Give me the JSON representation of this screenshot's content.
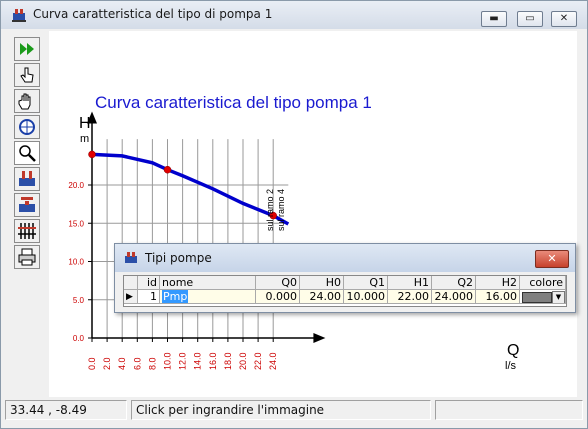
{
  "window": {
    "title": "Curva caratteristica del tipo di pompa 1"
  },
  "chart_data": {
    "type": "line",
    "title": "Curva caratteristica del tipo pompa 1",
    "ylabel": "H",
    "yunit": "m",
    "xlabel": "Q",
    "xunit": "l/s",
    "x_ticks": [
      "0.0",
      "2.0",
      "4.0",
      "6.0",
      "8.0",
      "10.0",
      "12.0",
      "14.0",
      "16.0",
      "18.0",
      "20.0",
      "22.0",
      "24.0"
    ],
    "y_ticks": [
      "0.0",
      "5.0",
      "10.0",
      "15.0",
      "20.0"
    ],
    "xlim": [
      0,
      28
    ],
    "ylim": [
      0,
      27
    ],
    "series": [
      {
        "x": [
          0,
          4,
          8,
          10,
          12,
          16,
          20,
          24,
          26
        ],
        "y": [
          24.0,
          23.8,
          22.9,
          22.0,
          21.2,
          19.5,
          17.6,
          16.0,
          14.9
        ]
      }
    ],
    "points": [
      {
        "x": 0,
        "y": 24.0
      },
      {
        "x": 10,
        "y": 22.0
      },
      {
        "x": 24,
        "y": 16.0
      }
    ],
    "annotations": [
      "sul ramo 2",
      "sul ramo 4"
    ],
    "grid": true,
    "color": "#0000cc",
    "tick_color": "#cc0000"
  },
  "statusbar": {
    "coords": "33.44 , -8.49",
    "message": "Click per ingrandire l'immagine"
  },
  "dialog": {
    "title": "Tipi pompe",
    "close_label": "✕",
    "columns": [
      "id",
      "nome",
      "Q0",
      "H0",
      "Q1",
      "H1",
      "Q2",
      "H2",
      "colore"
    ],
    "row": {
      "marker": "▶",
      "id": "1",
      "nome": "Pmp",
      "Q0": "0.000",
      "H0": "24.00",
      "Q1": "10.000",
      "H1": "22.00",
      "Q2": "24.000",
      "H2": "16.00"
    }
  }
}
